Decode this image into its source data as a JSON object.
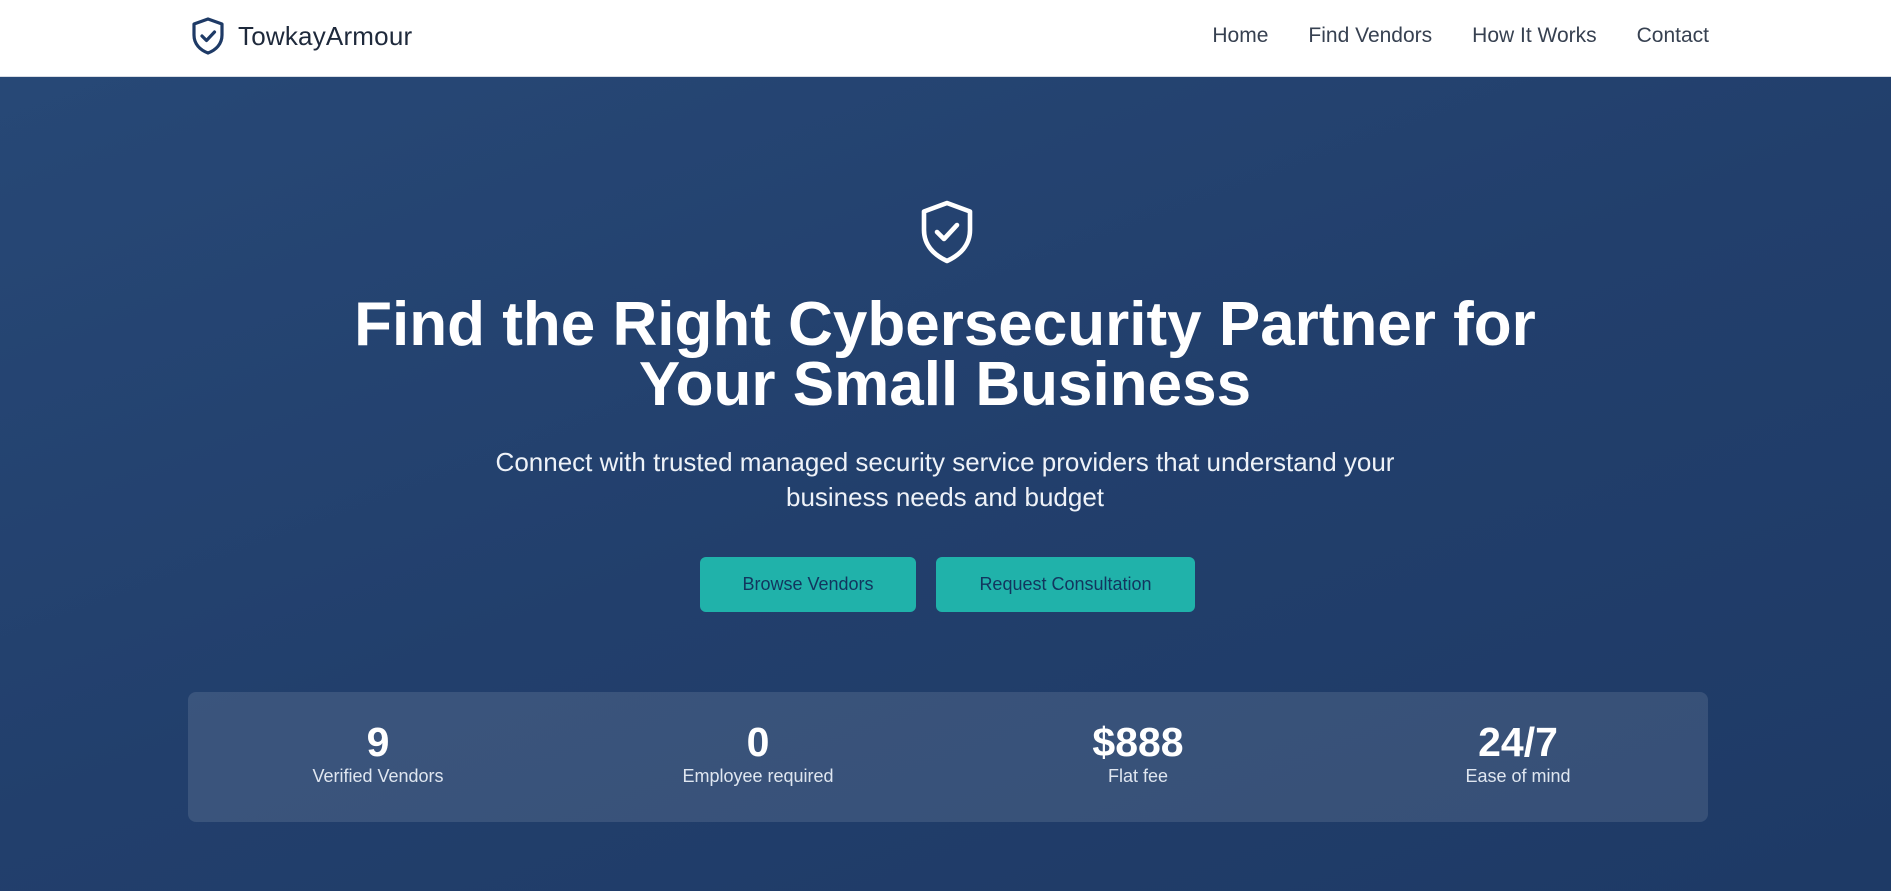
{
  "header": {
    "brand": "TowkayArmour",
    "nav": [
      "Home",
      "Find Vendors",
      "How It Works",
      "Contact"
    ]
  },
  "hero": {
    "title": "Find the Right Cybersecurity Partner for Your Small Business",
    "subtitle": "Connect with trusted managed security service providers that understand your business needs and budget",
    "buttons": {
      "browse": "Browse Vendors",
      "consult": "Request Consultation"
    }
  },
  "stats": [
    {
      "value": "9",
      "label": "Verified Vendors"
    },
    {
      "value": "0",
      "label": "Employee required"
    },
    {
      "value": "$888",
      "label": "Flat fee"
    },
    {
      "value": "24/7",
      "label": "Ease of mind"
    }
  ],
  "icons": {
    "brand": "shield-check-icon",
    "hero": "shield-check-icon"
  },
  "colors": {
    "brand_text": "#1e293b",
    "hero_bg": "#223f6c",
    "accent_button": "#20b2aa",
    "button_text": "#12355e"
  }
}
